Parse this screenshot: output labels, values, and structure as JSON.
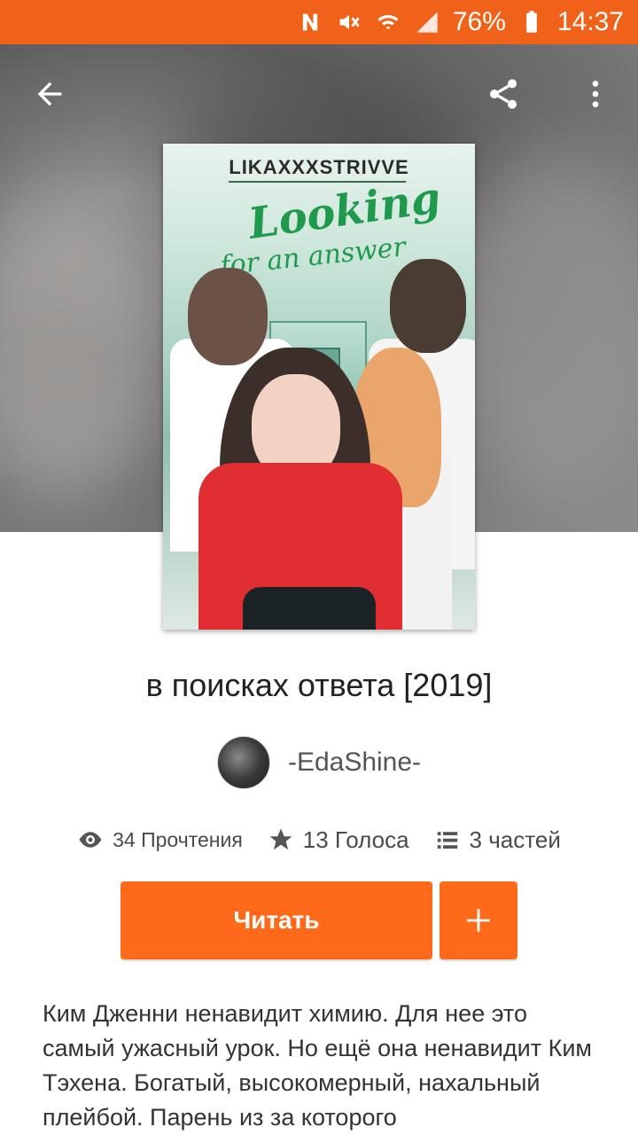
{
  "status_bar": {
    "battery": "76%",
    "time": "14:37",
    "bg_color": "#f0621a",
    "icons": [
      "nfc-icon",
      "mute-icon",
      "wifi-icon",
      "signal-icon",
      "battery-icon"
    ]
  },
  "topbar": {
    "back_icon": "arrow-left-icon",
    "share_icon": "share-icon",
    "more_icon": "more-vert-icon"
  },
  "cover": {
    "author_text": "LIKAXXXSTRIVVE",
    "title_line1": "Looking",
    "title_line2": "for an answer"
  },
  "story": {
    "title": "в поисках ответа [2019]",
    "author": "-EdaShine-",
    "reads": "34 Прочтения",
    "votes": "13 Голоса",
    "parts": "3 частей",
    "read_button": "Читать",
    "add_button": "+",
    "description": "Ким Дженни ненавидит химию. Для нее это самый ужасный урок. Но ещё она ненавидит Ким Тэхена. Богатый, высокомерный, нахальный плейбой. Парень из за которого"
  },
  "colors": {
    "accent": "#ff6a1a",
    "text_primary": "#222222",
    "text_secondary": "#555555"
  }
}
